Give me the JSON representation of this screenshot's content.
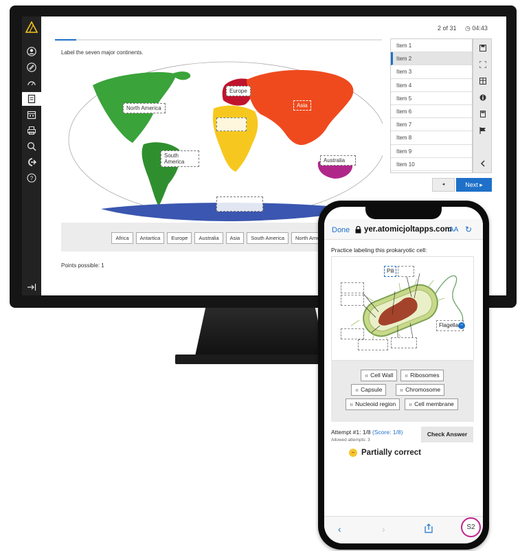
{
  "desktop": {
    "counter": "2 of 31",
    "timer": "04:43",
    "progress_fraction": 0.065,
    "question": "Label the seven major continents.",
    "map_labels": {
      "europe": "Europe",
      "asia": "Asia",
      "north_america": "North America",
      "south_america": "South America",
      "australia": "Australia"
    },
    "word_bank": [
      "Africa",
      "Antartica",
      "Europe",
      "Australia",
      "Asia",
      "South America",
      "North America"
    ],
    "points": "Points possible: 1",
    "items": [
      "Item 1",
      "Item 2",
      "Item 3",
      "Item 4",
      "Item 5",
      "Item 6",
      "Item 7",
      "Item 8",
      "Item 9",
      "Item 10"
    ],
    "selected_item": "Item 2",
    "next_label": "Next ▸",
    "prev_label": "◂",
    "sidebar_icons": [
      "logo-icon",
      "user-icon",
      "tag-icon",
      "gauge-icon",
      "page-icon",
      "calendar-icon",
      "printer-icon",
      "search-icon",
      "logout-icon",
      "help-icon",
      "collapse-icon"
    ],
    "tool_icons": [
      "save-icon",
      "fullscreen-icon",
      "grid-icon",
      "info-icon",
      "calculator-icon",
      "flag-icon",
      "chevron-left-icon"
    ]
  },
  "phone": {
    "done": "Done",
    "url": "yer.atomicjoltapps.com",
    "aa": "AA",
    "question": "Practice labeling this prokaryotic cell:",
    "cell_labels": {
      "pili": "Pili",
      "flagella": "Flagella"
    },
    "word_bank": [
      "Cell Wall",
      "Ribosomes",
      "Capsule",
      "Chromosome",
      "Nucleoid region",
      "Cell membrane"
    ],
    "attempt_label": "Attempt #1: 1/8",
    "score_label": "(Score: 1/8)",
    "allowed": "Allowed attempts: 3",
    "check_button": "Check Answer",
    "feedback": "Partially correct",
    "badge": "S2"
  },
  "colors": {
    "accent": "#1e70c9",
    "north_america": "#3aa33a",
    "south_america": "#2f8f2f",
    "europe": "#c0142e",
    "asia": "#ef4a1e",
    "africa": "#f6c81f",
    "australia": "#b0278a",
    "antarctica": "#3a56b0",
    "badge_ring": "#c0238e"
  }
}
